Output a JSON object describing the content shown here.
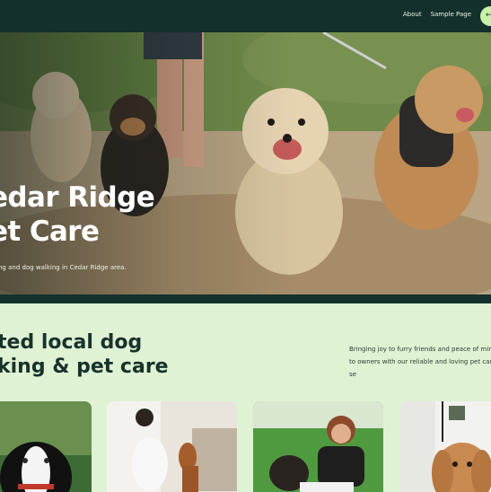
{
  "header": {
    "nav": [
      {
        "label": "About"
      },
      {
        "label": "Sample Page"
      }
    ],
    "cta_glyph": "←"
  },
  "hero": {
    "title": "edar Ridge\net Care",
    "subtitle": "ng and dog walking in Cedar Ridge area."
  },
  "intro": {
    "heading": "ted local dog\nking & pet care",
    "text": "Bringing joy to furry friends and peace of mind to owners with our reliable and loving pet care se"
  },
  "cards": [
    {
      "name": "card-border-collie"
    },
    {
      "name": "card-woman-dachshund"
    },
    {
      "name": "card-girl-dog-lawn"
    },
    {
      "name": "card-cocker-spaniel"
    }
  ],
  "colors": {
    "header_bg": "#13302c",
    "page_bg": "#dff2d3",
    "accent": "#c8f2a9",
    "heading": "#18322c"
  }
}
